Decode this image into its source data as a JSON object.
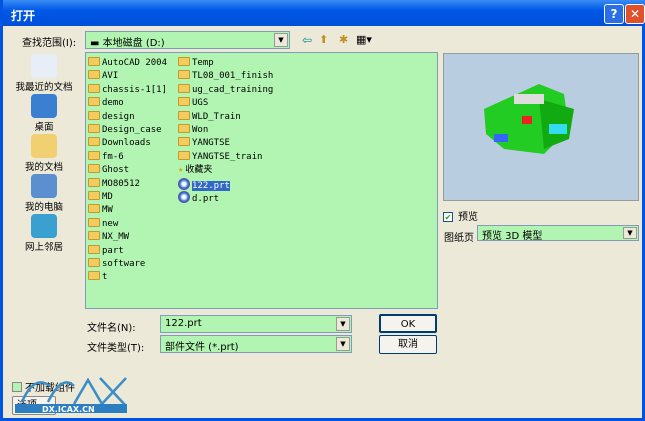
{
  "title": "打开",
  "title_buttons": {
    "help": "?",
    "close": "✕"
  },
  "look_in": {
    "label": "查找范围(I):",
    "value": "本地磁盘 (D:)"
  },
  "toolbar": {
    "back": "⇦",
    "up": "⬆",
    "new_folder": "✱",
    "views": "▦▾"
  },
  "places": [
    {
      "label": "我最近的文档"
    },
    {
      "label": "桌面"
    },
    {
      "label": "我的文档"
    },
    {
      "label": "我的电脑"
    },
    {
      "label": "网上邻居"
    }
  ],
  "files_col1": [
    "AutoCAD 2004",
    "AVI",
    "chassis-1[1]",
    "demo",
    "design",
    "Design_case",
    "Downloads",
    "fm-6",
    "Ghost",
    "MO80512",
    "MD",
    "MW",
    "new",
    "NX_MW",
    "part",
    "software",
    "t"
  ],
  "files_col2": [
    {
      "name": "Temp",
      "type": "folder"
    },
    {
      "name": "TL08_001_finish",
      "type": "folder"
    },
    {
      "name": "ug_cad_training",
      "type": "folder"
    },
    {
      "name": "UGS",
      "type": "folder"
    },
    {
      "name": "WLD_Train",
      "type": "folder"
    },
    {
      "name": "Won",
      "type": "folder"
    },
    {
      "name": "YANGTSE",
      "type": "folder"
    },
    {
      "name": "YANGTSE_train",
      "type": "folder"
    },
    {
      "name": "收藏夹",
      "type": "favorites"
    },
    {
      "name": "122.prt",
      "type": "prt",
      "selected": true
    },
    {
      "name": "d.prt",
      "type": "prt"
    }
  ],
  "filename": {
    "label": "文件名(N):",
    "value": "122.prt"
  },
  "filetype": {
    "label": "文件类型(T):",
    "value": "部件文件 (*.prt)"
  },
  "ok": "OK",
  "cancel": "取消",
  "preview": {
    "checkbox_label": "预览",
    "checked": true,
    "sheet_label": "图纸页",
    "sheet_value": "预览 3D 模型"
  },
  "no_load_components": "不加载组件",
  "options": "选项",
  "watermark": "DX.ICAX.CN"
}
